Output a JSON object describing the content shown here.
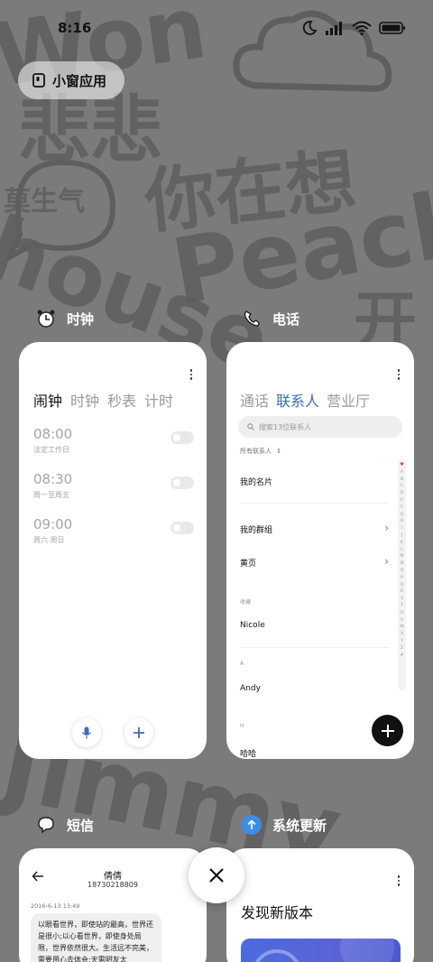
{
  "status_bar": {
    "time": "8:16",
    "icons": [
      "moon-icon",
      "signal-icon",
      "wifi-icon",
      "battery-icon"
    ]
  },
  "small_window": {
    "label": "小窗应用"
  },
  "wallpaper": {
    "texts": [
      "Won",
      "悲悲",
      "莫生气",
      "你在想",
      "Peach",
      "house",
      "开",
      "Jimmy"
    ]
  },
  "apps": {
    "clock": {
      "name": "时钟",
      "tabs": [
        "闹钟",
        "时钟",
        "秒表",
        "计时"
      ],
      "alarms": [
        {
          "time": "08:00",
          "repeat": "法定工作日"
        },
        {
          "time": "08:30",
          "repeat": "周一至周五"
        },
        {
          "time": "09:00",
          "repeat": "周六 周日"
        }
      ]
    },
    "phone": {
      "name": "电话",
      "tabs": [
        "通话",
        "联系人",
        "营业厅"
      ],
      "search_placeholder": "搜索13位联系人",
      "filter": "所有联系人",
      "my_card": "我的名片",
      "my_groups": "我的群组",
      "yellow_pages": "黄页",
      "favorites_header": "收藏",
      "favorite_contact": "Nicole",
      "section_a": "A",
      "contact_a": "Andy",
      "section_h": "H",
      "contact_h": "哈哈",
      "index": [
        "♥",
        "A",
        "B",
        "C",
        "D",
        "E",
        "F",
        "G",
        "H",
        "I",
        "J",
        "K",
        "L",
        "M",
        "N",
        "O",
        "P",
        "Q",
        "R",
        "S",
        "T",
        "U",
        "V",
        "W",
        "X",
        "Y",
        "Z",
        "#"
      ]
    },
    "sms": {
      "name": "短信",
      "contact_name": "倩倩",
      "contact_number": "18730218809",
      "date": "2016-6-13 13:49",
      "message": "以眼看世界，即使站的最高，世界还是很小;以心看世界，即使身处局限，世界依然很大。生活远不完美，需要用心去体会;天需明友太"
    },
    "update": {
      "name": "系统更新",
      "title": "发现新版本"
    }
  },
  "colors": {
    "accent_blue": "#3a6eb5",
    "wallpaper_bg": "#7b7b7b",
    "fab": "#111111"
  }
}
